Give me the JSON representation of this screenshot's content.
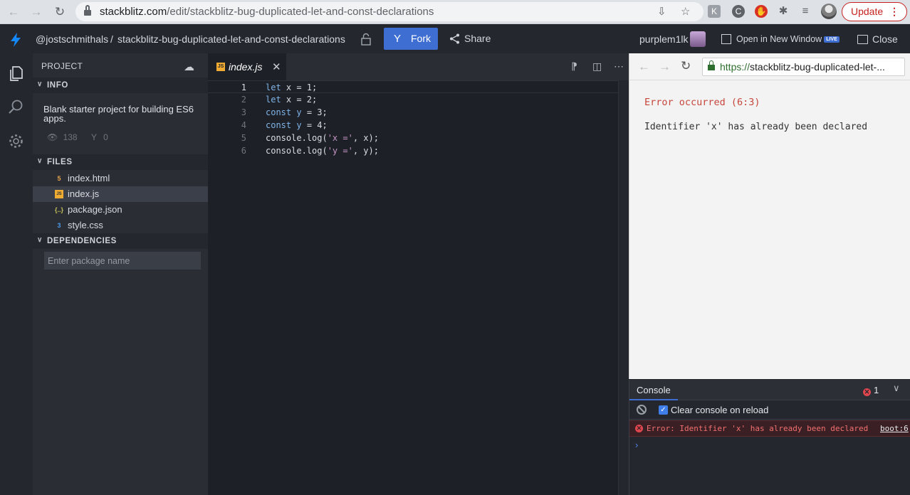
{
  "browser": {
    "url_host": "stackblitz.com",
    "url_path": "/edit/stackblitz-bug-duplicated-let-and-const-declarations",
    "update_label": "Update"
  },
  "topbar": {
    "owner": "@jostschmithals",
    "separator": "/",
    "project": "stackblitz-bug-duplicated-let-and-const-declarations",
    "fork_label": "Fork",
    "share_label": "Share",
    "username": "purplem1lk",
    "open_new_label": "Open in New Window",
    "live_badge": "LIVE",
    "close_label": "Close"
  },
  "sidebar": {
    "header": "PROJECT",
    "info_label": "INFO",
    "description": "Blank starter project for building ES6 apps.",
    "views": "138",
    "forks": "0",
    "files_label": "FILES",
    "files": [
      {
        "name": "index.html",
        "icon": "html-file-icon",
        "color": "#e8a54b"
      },
      {
        "name": "index.js",
        "icon": "js-file-icon",
        "color": "#f0ac32"
      },
      {
        "name": "package.json",
        "icon": "json-file-icon",
        "color": "#c5c25b"
      },
      {
        "name": "style.css",
        "icon": "css-file-icon",
        "color": "#4c9be8"
      }
    ],
    "dependencies_label": "DEPENDENCIES",
    "package_placeholder": "Enter package name"
  },
  "editor": {
    "tab_name": "index.js",
    "tab_badge": "JS",
    "lines": [
      {
        "n": "1",
        "code": "let x = 1;"
      },
      {
        "n": "2",
        "code": "let x = 2;"
      },
      {
        "n": "3",
        "code": "const y = 3;"
      },
      {
        "n": "4",
        "code": "const y = 4;"
      },
      {
        "n": "5",
        "code": "console.log('x =', x);"
      },
      {
        "n": "6",
        "code": "console.log('y =', y);"
      }
    ]
  },
  "preview": {
    "url_scheme": "https://",
    "url_host": "stackblitz-bug-duplicated-let-...",
    "error_title": "Error occurred (6:3)",
    "error_message": "Identifier 'x' has already been declared"
  },
  "console": {
    "tab_label": "Console",
    "error_count": "1",
    "clear_label": "Clear console on reload",
    "error_line": "Error: Identifier 'x' has already been declared",
    "error_source": "boot:6",
    "prompt": "›"
  },
  "colors": {
    "accent": "#3f6ed2",
    "error": "#e0464e"
  }
}
